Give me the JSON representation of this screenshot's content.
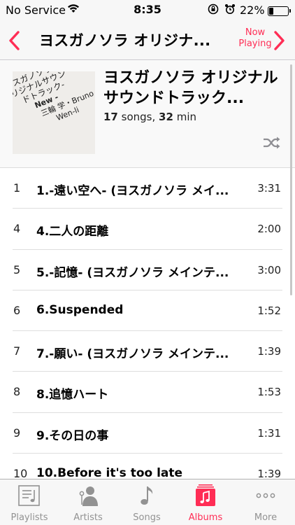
{
  "status_bar": {
    "carrier": "No Service",
    "time": "8:35",
    "battery_percent": "22%",
    "battery_level": 0.22
  },
  "nav": {
    "title": "ヨスガノソラ オリジナ...",
    "now_playing": "Now Playing"
  },
  "album": {
    "title": "ヨスガノソラ オリジナルサウンドトラック...",
    "song_count": "17",
    "songs_label": "songs,",
    "duration": "32",
    "duration_unit": "min",
    "art": {
      "lines": [
        "ヨスガノソラ オ",
        "リジナルサウン",
        "ドトラック-",
        "New -",
        "三輪 学・Bruno",
        "Wen-li"
      ]
    }
  },
  "tracks": [
    {
      "no": "1",
      "title": "1.-遠い空へ- (ヨスガノソラ メイ...",
      "duration": "3:31"
    },
    {
      "no": "4",
      "title": "4.二人の距離",
      "duration": "2:00"
    },
    {
      "no": "5",
      "title": "5.-記憶- (ヨスガノソラ メインテ...",
      "duration": "3:00"
    },
    {
      "no": "6",
      "title": "6.Suspended",
      "duration": "1:52"
    },
    {
      "no": "7",
      "title": "7.-願い- (ヨスガノソラ メインテ...",
      "duration": "1:39"
    },
    {
      "no": "8",
      "title": "8.追憶ハート",
      "duration": "1:53"
    },
    {
      "no": "9",
      "title": "9.その日の事",
      "duration": "1:31"
    },
    {
      "no": "10",
      "title": "10.Before it's too late",
      "duration": "1:39"
    }
  ],
  "tabs": [
    {
      "label": "Playlists",
      "icon": "playlists-icon"
    },
    {
      "label": "Artists",
      "icon": "artists-icon"
    },
    {
      "label": "Songs",
      "icon": "songs-icon"
    },
    {
      "label": "Albums",
      "icon": "albums-icon",
      "active": true
    },
    {
      "label": "More",
      "icon": "more-icon"
    }
  ],
  "colors": {
    "accent": "#ff2d55",
    "inactive_tab": "#929292"
  }
}
